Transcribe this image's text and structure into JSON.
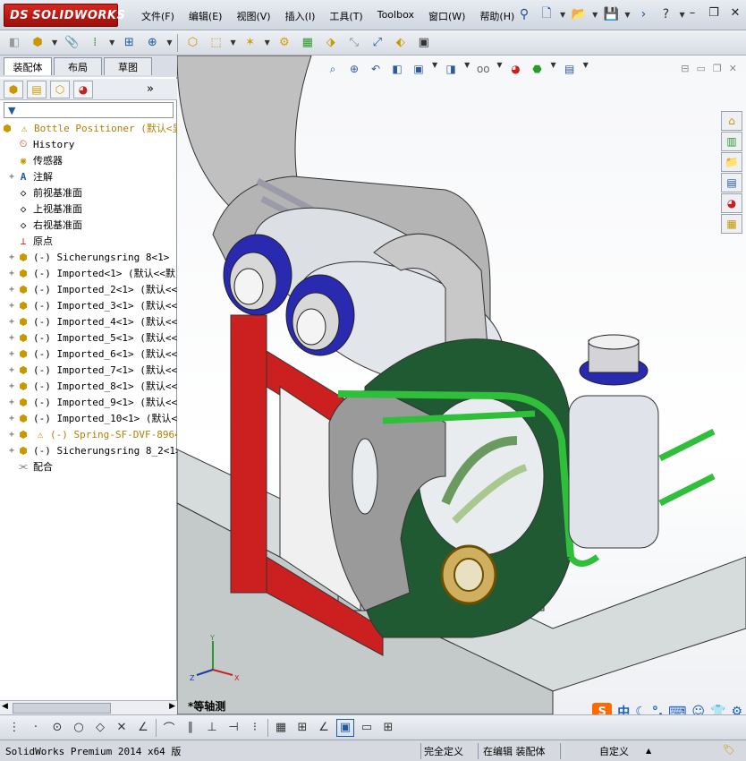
{
  "app": {
    "brand": "SOLIDWORKS",
    "brand_prefix": "DS"
  },
  "menu": [
    "文件(F)",
    "编辑(E)",
    "视图(V)",
    "插入(I)",
    "工具(T)",
    "Toolbox",
    "窗口(W)",
    "帮助(H)"
  ],
  "left_tabs": [
    "装配体",
    "布局",
    "草图"
  ],
  "tree": {
    "root": "Bottle Positioner  (默认<显",
    "items": [
      {
        "label": "History",
        "icon": "history-icon",
        "expand": ""
      },
      {
        "label": "传感器",
        "icon": "sensor-icon",
        "expand": ""
      },
      {
        "label": "注解",
        "icon": "annotation-icon",
        "expand": "+"
      },
      {
        "label": "前视基准面",
        "icon": "plane-icon",
        "expand": ""
      },
      {
        "label": "上视基准面",
        "icon": "plane-icon",
        "expand": ""
      },
      {
        "label": "右视基准面",
        "icon": "plane-icon",
        "expand": ""
      },
      {
        "label": "原点",
        "icon": "origin-icon",
        "expand": ""
      },
      {
        "label": "(-) Sicherungsring 8<1> (默",
        "icon": "part-icon",
        "expand": "+"
      },
      {
        "label": "(-) Imported<1> (默认<<默",
        "icon": "part-icon",
        "expand": "+"
      },
      {
        "label": "(-) Imported_2<1> (默认<<",
        "icon": "part-icon",
        "expand": "+"
      },
      {
        "label": "(-) Imported_3<1> (默认<<",
        "icon": "part-icon",
        "expand": "+"
      },
      {
        "label": "(-) Imported_4<1> (默认<<",
        "icon": "part-icon",
        "expand": "+"
      },
      {
        "label": "(-) Imported_5<1> (默认<<",
        "icon": "part-icon",
        "expand": "+"
      },
      {
        "label": "(-) Imported_6<1> (默认<<",
        "icon": "part-icon",
        "expand": "+"
      },
      {
        "label": "(-) Imported_7<1> (默认<<",
        "icon": "part-icon",
        "expand": "+"
      },
      {
        "label": "(-) Imported_8<1> (默认<<",
        "icon": "part-icon",
        "expand": "+"
      },
      {
        "label": "(-) Imported_9<1> (默认<<",
        "icon": "part-icon",
        "expand": "+"
      },
      {
        "label": "(-) Imported_10<1> (默认<",
        "icon": "part-icon",
        "expand": "+"
      },
      {
        "label": "(-) Spring-SF-DVF-8964-",
        "icon": "warning-part-icon",
        "expand": "+"
      },
      {
        "label": "(-) Sicherungsring 8_2<1>",
        "icon": "part-icon",
        "expand": "+"
      },
      {
        "label": "配合",
        "icon": "mates-icon",
        "expand": ""
      }
    ]
  },
  "viewport": {
    "view_label": "*等轴测",
    "triad": {
      "x": "X",
      "y": "Y",
      "z": "Z"
    }
  },
  "ime": {
    "logo": "S",
    "mode": "中"
  },
  "status": {
    "left": "SolidWorks Premium 2014 x64 版",
    "defined": "完全定义",
    "editing": "在编辑 装配体",
    "custom": "自定义"
  },
  "colors": {
    "brand_red": "#c8201a",
    "frame_gray": "#b8b8b8",
    "frame_red": "#cc1f1f",
    "wheel_green": "#1f5a32",
    "tube_green": "#2fbf3a",
    "bottle_blue": "#2a2ab0"
  }
}
